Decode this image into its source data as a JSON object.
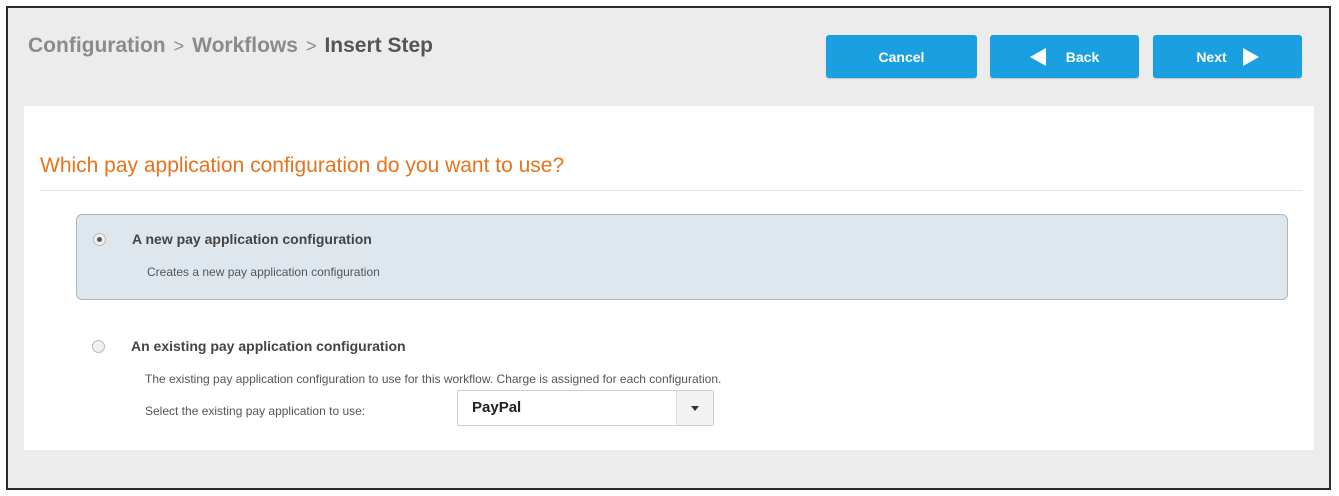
{
  "breadcrumb": {
    "items": [
      "Configuration",
      "Workflows",
      "Insert Step"
    ],
    "separator": ">"
  },
  "toolbar": {
    "cancel_label": "Cancel",
    "back_label": "Back",
    "next_label": "Next"
  },
  "question": "Which pay application configuration do you want to use?",
  "options": [
    {
      "title": "A new pay application configuration",
      "description": "Creates a new pay application configuration",
      "selected": true
    },
    {
      "title": "An existing pay application configuration",
      "description": "The existing pay application configuration to use for this workflow. Charge is assigned for each configuration.",
      "selected": false
    }
  ],
  "existing_select": {
    "label": "Select the existing pay application to use:",
    "value": "PayPal"
  },
  "colors": {
    "accent_button": "#1aa0e0",
    "question_text": "#e8731c",
    "selected_option_bg": "#dfe7ee"
  },
  "icons": {
    "back": "triangle-left-icon",
    "next": "triangle-right-icon",
    "dropdown": "caret-down-icon"
  }
}
